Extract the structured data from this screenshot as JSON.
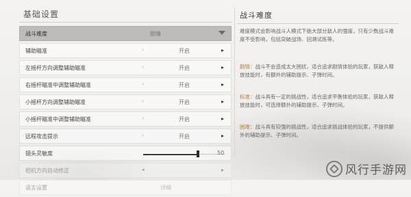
{
  "left_panel": {
    "section_title": "基础设置",
    "settings": [
      {
        "label": "战斗难度",
        "value": "剧情",
        "control": "dropdown",
        "selected": true
      },
      {
        "label": "辅助瞄准",
        "value": "开启",
        "control": "toggle"
      },
      {
        "label": "左摇杆方向调整辅助瞄准",
        "value": "开启",
        "control": "toggle"
      },
      {
        "label": "右摇杆瞄准中调整辅助瞄准",
        "value": "开启",
        "control": "toggle"
      },
      {
        "label": "小摇杆方向调整辅助瞄准",
        "value": "开启",
        "control": "toggle"
      },
      {
        "label": "小摇杆瞄准中调整辅助瞄准",
        "value": "开启",
        "control": "toggle"
      },
      {
        "label": "远程攻击提示",
        "value": "开启",
        "control": "toggle"
      },
      {
        "label": "镜头灵敏度",
        "value": "50",
        "control": "slider",
        "level": 0.72
      },
      {
        "label": "相机方向自动修正",
        "value": "",
        "control": "toggle",
        "faded": true
      },
      {
        "label": "语言设置",
        "value": "详细",
        "control": "toggle",
        "faded": true
      }
    ],
    "arrow_left": "‹",
    "arrow_right": "▸",
    "arrow_left_bold": "◂"
  },
  "right_panel": {
    "title": "战斗难度",
    "intro": "难度模式会影响战斗人模式下绝大部分敌人的强度，只有少数战斗难度不受影响，包括突破战场、回溯试炼等。",
    "modes": [
      {
        "name": "剧情",
        "sep": "：",
        "text": "战斗不会造成太大困扰，适合追求剧情体验的玩家，获敌人释放技能时，有额外的辅助提示、子弹时间。"
      },
      {
        "name": "标准",
        "sep": "：",
        "text": "战斗具有一定的挑战性，适合追求平衡体验的玩家，获敌人释放技能时，可选择额外的辅助提示、子弹时间。"
      },
      {
        "name": "困难",
        "sep": "：",
        "text": "战斗具有较强的挑战性，适合追求挑战体验的玩家，不提供额外的辅助提示、子弹时间。"
      }
    ]
  },
  "watermark": {
    "text": "风行手游网",
    "icon": "fengxing-logo-icon"
  },
  "colors": {
    "mode_name": "#b8793a",
    "selected_row": "#bdbcb8",
    "background": "#f1f0ee"
  }
}
